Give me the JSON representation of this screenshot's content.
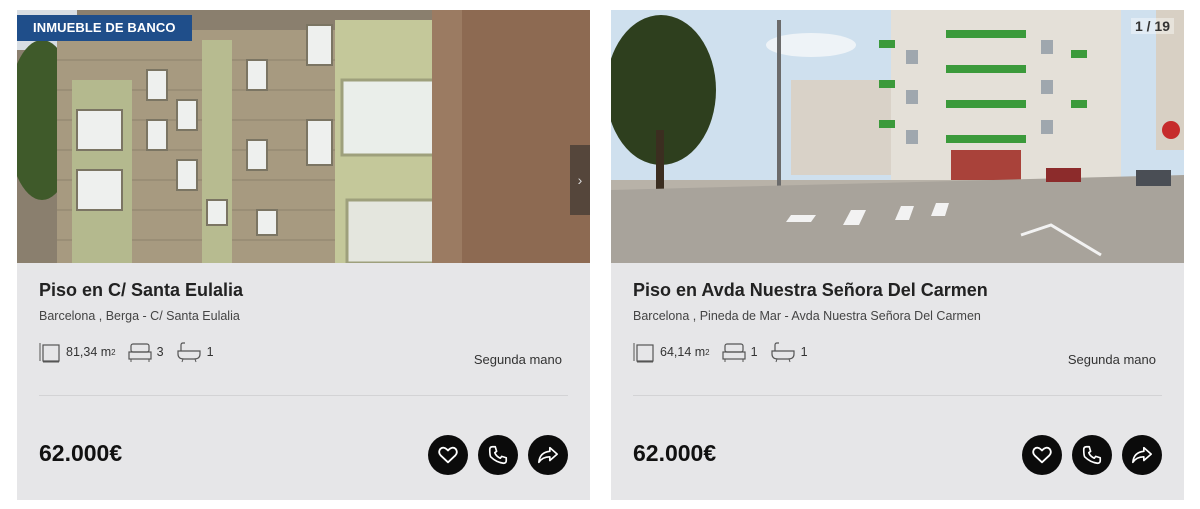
{
  "listings": [
    {
      "badge": "INMUEBLE DE BANCO",
      "title": "Piso en C/ Santa Eulalia",
      "location": "Barcelona , Berga - C/ Santa Eulalia",
      "area": "81,34 m",
      "area_unit_sup": "2",
      "bedrooms": "3",
      "bathrooms": "1",
      "condition": "Segunda mano",
      "price": "62.000€",
      "next_arrow": "›"
    },
    {
      "photo_counter": "1 / 19",
      "title": "Piso en Avda Nuestra Señora Del Carmen",
      "location": "Barcelona , Pineda de Mar - Avda Nuestra Señora Del Carmen",
      "area": "64,14 m",
      "area_unit_sup": "2",
      "bedrooms": "1",
      "bathrooms": "1",
      "condition": "Segunda mano",
      "price": "62.000€"
    }
  ],
  "icons": [
    "area-icon",
    "bed-icon",
    "bath-icon",
    "heart-icon",
    "phone-icon",
    "share-icon",
    "chevron-right-icon"
  ],
  "colors": {
    "badge_bg": "#1f4e8a",
    "card_bg": "#e6e6e8",
    "button_bg": "#0b0b0b"
  }
}
